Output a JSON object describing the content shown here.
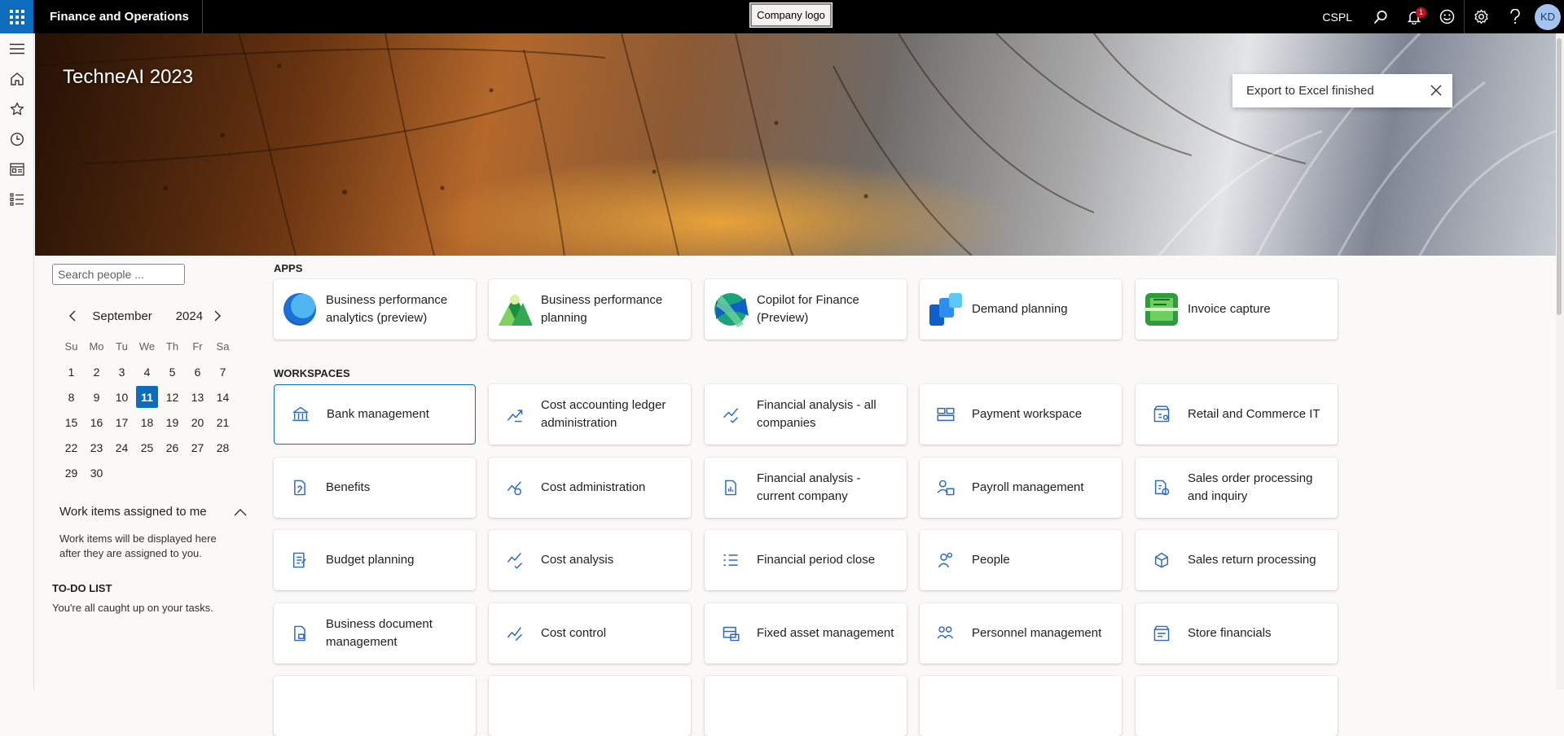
{
  "topbar": {
    "app_title": "Finance and Operations",
    "company_logo": "Company logo",
    "company": "CSPL",
    "notification_count": "1",
    "user_initials": "KD"
  },
  "hero": {
    "title": "TechneAI 2023"
  },
  "toast": {
    "message": "Export to Excel finished"
  },
  "sidebar": {
    "search_placeholder": "Search people ...",
    "calendar": {
      "month": "September",
      "year": "2024",
      "weekdays": [
        "Su",
        "Mo",
        "Tu",
        "We",
        "Th",
        "Fr",
        "Sa"
      ],
      "days": [
        "1",
        "2",
        "3",
        "4",
        "5",
        "6",
        "7",
        "8",
        "9",
        "10",
        "11",
        "12",
        "13",
        "14",
        "15",
        "16",
        "17",
        "18",
        "19",
        "20",
        "21",
        "22",
        "23",
        "24",
        "25",
        "26",
        "27",
        "28",
        "29",
        "30"
      ],
      "today": "11"
    },
    "work_items": {
      "title": "Work items assigned to me",
      "description": "Work items will be displayed here after they are assigned to you."
    },
    "todo": {
      "title": "TO-DO LIST",
      "text": "You're all caught up on your tasks."
    }
  },
  "apps": {
    "title": "APPS",
    "items": [
      {
        "label": "Business performance analytics (preview)",
        "icon": "bpa-app-icon"
      },
      {
        "label": "Business performance planning",
        "icon": "bpp-app-icon"
      },
      {
        "label": "Copilot for Finance (Preview)",
        "icon": "copilot-app-icon"
      },
      {
        "label": "Demand planning",
        "icon": "demand-planning-app-icon"
      },
      {
        "label": "Invoice capture",
        "icon": "invoice-capture-app-icon"
      }
    ]
  },
  "workspaces": {
    "title": "WORKSPACES",
    "rows": [
      [
        "Bank management",
        "Cost accounting ledger administration",
        "Financial analysis - all companies",
        "Payment workspace",
        "Retail and Commerce IT"
      ],
      [
        "Benefits",
        "Cost administration",
        "Financial analysis - current company",
        "Payroll management",
        "Sales order processing and inquiry"
      ],
      [
        "Budget planning",
        "Cost analysis",
        "Financial period close",
        "People",
        "Sales return processing"
      ],
      [
        "Business document management",
        "Cost control",
        "Fixed asset management",
        "Personnel management",
        "Store financials"
      ]
    ]
  },
  "colors": {
    "accent": "#0f6cbd",
    "topbar": "#000000",
    "icon_blue": "#2b67c9"
  }
}
